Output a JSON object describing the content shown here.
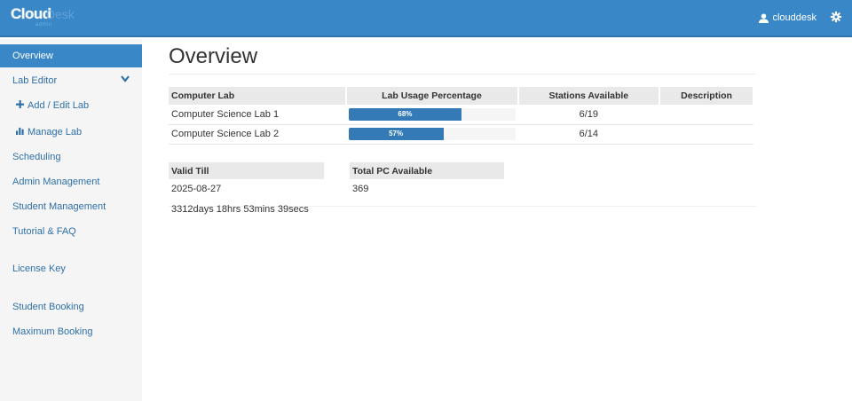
{
  "header": {
    "logo_word1": "Cloud",
    "logo_word2": "Desk",
    "logo_sub": "admin",
    "username": "clouddesk"
  },
  "sidebar": {
    "items": [
      {
        "label": "Overview"
      },
      {
        "label": "Lab Editor"
      },
      {
        "label": "Add / Edit Lab"
      },
      {
        "label": "Manage Lab"
      },
      {
        "label": "Scheduling"
      },
      {
        "label": "Admin Management"
      },
      {
        "label": "Student Management"
      },
      {
        "label": "Tutorial & FAQ"
      },
      {
        "label": "License Key"
      },
      {
        "label": "Student Booking"
      },
      {
        "label": "Maximum Booking"
      }
    ]
  },
  "page": {
    "title": "Overview"
  },
  "labs_table": {
    "headers": [
      "Computer Lab",
      "Lab Usage Percentage",
      "Stations Available",
      "Description"
    ],
    "rows": [
      {
        "name": "Computer Science Lab 1",
        "usage_label": "68%",
        "usage": 68,
        "stations": "6/19",
        "description": ""
      },
      {
        "name": "Computer Science Lab 2",
        "usage_label": "57%",
        "usage": 57,
        "stations": "6/14",
        "description": ""
      }
    ]
  },
  "license": {
    "valid_till_header": "Valid Till",
    "valid_till": "2025-08-27",
    "countdown": "3312days 18hrs 53mins 39secs",
    "total_pc_header": "Total PC Available",
    "total_pc": "369"
  },
  "colors": {
    "accent": "#3a87c8",
    "progress": "#337ab7",
    "link": "#2e6fa8"
  }
}
